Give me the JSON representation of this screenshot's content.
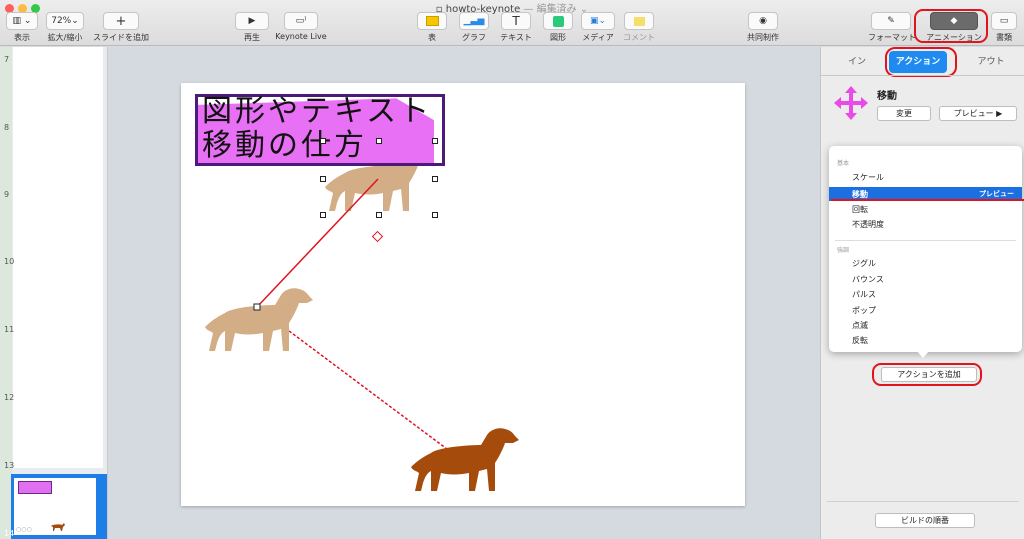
{
  "window": {
    "title": "howto-keynote",
    "subtitle": "— 編集済み ⌄"
  },
  "toolbar": {
    "view_label": "表示",
    "zoom_value": "72%",
    "zoom_label": "拡大/縮小",
    "add_slide_label": "スライドを追加",
    "play_label": "再生",
    "keynote_live_label": "Keynote Live",
    "table_label": "表",
    "chart_label": "グラフ",
    "text_label": "テキスト",
    "shape_label": "図形",
    "media_label": "メディア",
    "comment_label": "コメント",
    "collaborate_label": "共同制作",
    "format_label": "フォーマット",
    "animate_label": "アニメーション",
    "document_label": "書類"
  },
  "navigator": {
    "slide_numbers": [
      "7",
      "8",
      "9",
      "10",
      "11",
      "12",
      "13",
      "14"
    ],
    "thumb_dots": "○○○"
  },
  "slide": {
    "title_line1": "図形やテキスト",
    "title_line2": "移動の仕方"
  },
  "inspector": {
    "tabs": {
      "in": "イン",
      "action": "アクション",
      "out": "アウト"
    },
    "effect_name": "移動",
    "change_button": "変更",
    "preview_button": "プレビュー ▶",
    "menu": {
      "basic_category": "基本",
      "emphasis_category": "強調",
      "items_basic": [
        "スケール",
        "移動",
        "回転",
        "不透明度"
      ],
      "items_emphasis": [
        "ジグル",
        "バウンス",
        "パルス",
        "ポップ",
        "点滅",
        "反転"
      ],
      "selected_preview": "プレビュー"
    },
    "add_action_button": "アクションを追加",
    "build_order_button": "ビルドの順番"
  },
  "colors": {
    "accent_blue": "#1f8bf0",
    "highlight_red": "#e0141e",
    "title_highlight": "#e870f5",
    "dog_ghost": "#d2ad85",
    "dog_final": "#a54c0c"
  }
}
